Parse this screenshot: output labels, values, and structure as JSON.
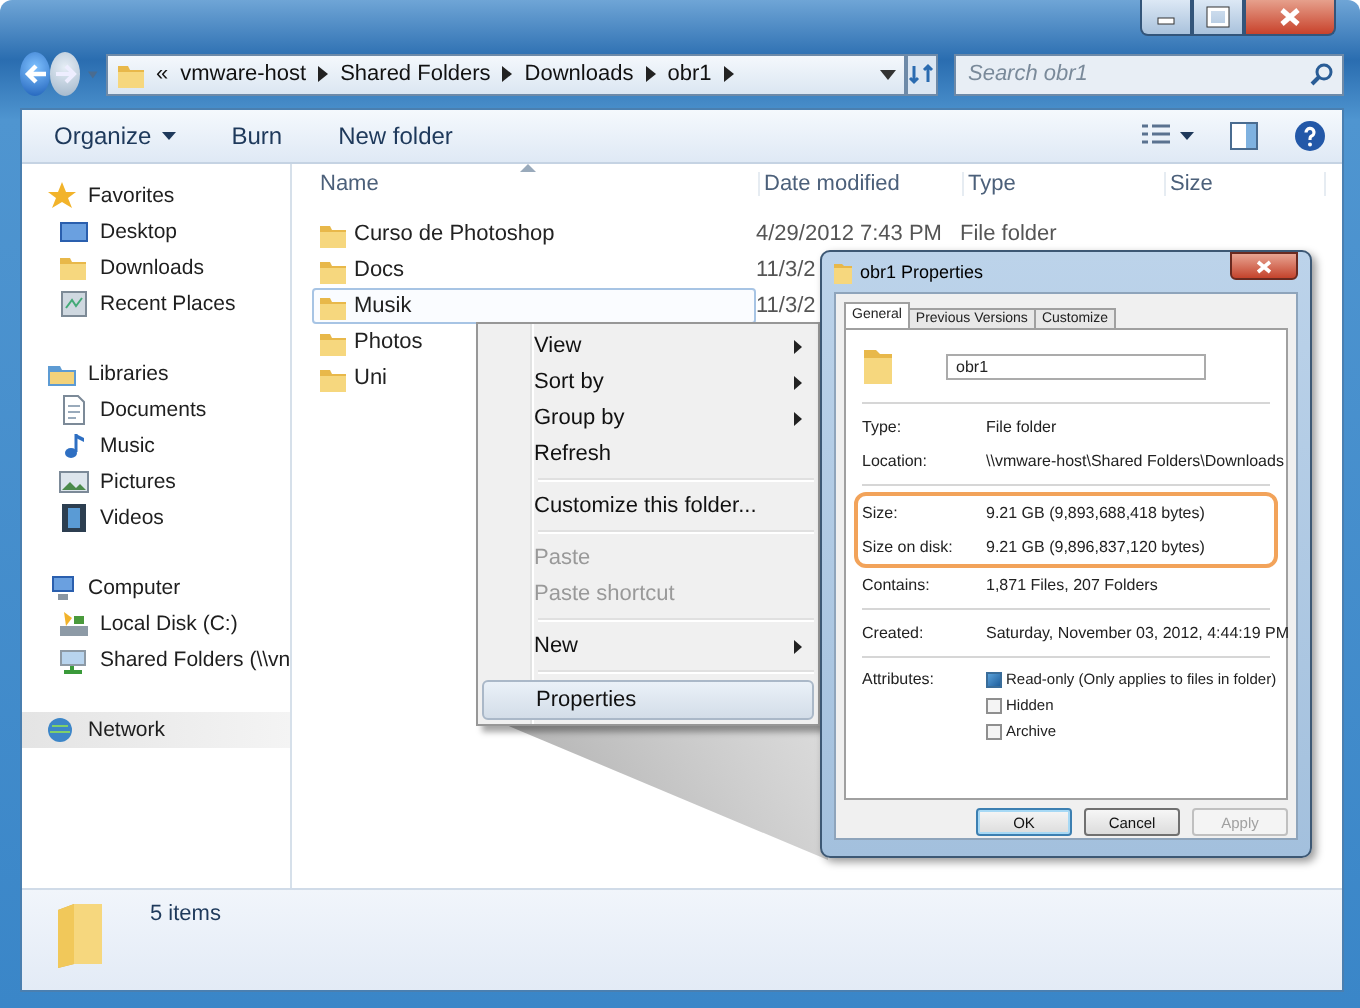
{
  "address_bar": {
    "overflow": "«",
    "crumbs": [
      "vmware-host",
      "Shared Folders",
      "Downloads",
      "obr1"
    ]
  },
  "search": {
    "placeholder": "Search obr1"
  },
  "toolbar": {
    "buttons": [
      {
        "label": "Organize",
        "dropdown": true
      },
      {
        "label": "Burn",
        "dropdown": false
      },
      {
        "label": "New folder",
        "dropdown": false
      }
    ]
  },
  "sidebar": {
    "groups": [
      {
        "label": "Favorites",
        "kind": "star",
        "selected": false,
        "children": [
          {
            "label": "Desktop",
            "kind": "desktop"
          },
          {
            "label": "Downloads",
            "kind": "folder"
          },
          {
            "label": "Recent Places",
            "kind": "recent"
          }
        ]
      },
      {
        "label": "Libraries",
        "kind": "library",
        "selected": false,
        "children": [
          {
            "label": "Documents",
            "kind": "document"
          },
          {
            "label": "Music",
            "kind": "music"
          },
          {
            "label": "Pictures",
            "kind": "pictures"
          },
          {
            "label": "Videos",
            "kind": "videos"
          }
        ]
      },
      {
        "label": "Computer",
        "kind": "computer",
        "selected": false,
        "children": [
          {
            "label": "Local Disk (C:)",
            "kind": "disk"
          },
          {
            "label": "Shared Folders (\\\\vn",
            "kind": "share"
          }
        ]
      },
      {
        "label": "Network",
        "kind": "network",
        "selected": true
      }
    ]
  },
  "table": {
    "columns": [
      "Name",
      "Date modified",
      "Type",
      "Size"
    ],
    "rows": [
      {
        "name": "Curso de Photoshop",
        "date": "4/29/2012 7:43 PM",
        "type": "File folder",
        "selected": false
      },
      {
        "name": "Docs",
        "date": "11/3/2",
        "selected": false
      },
      {
        "name": "Musik",
        "date": "11/3/2",
        "selected": true
      },
      {
        "name": "Photos",
        "selected": false
      },
      {
        "name": "Uni",
        "selected": false
      }
    ]
  },
  "context_menu": {
    "items": [
      {
        "kind": "item",
        "label": "View",
        "submenu": true,
        "disabled": false,
        "selected": false
      },
      {
        "kind": "item",
        "label": "Sort by",
        "submenu": true,
        "disabled": false,
        "selected": false
      },
      {
        "kind": "item",
        "label": "Group by",
        "submenu": true,
        "disabled": false,
        "selected": false
      },
      {
        "kind": "item",
        "label": "Refresh",
        "submenu": false,
        "disabled": false,
        "selected": false
      },
      {
        "kind": "separator"
      },
      {
        "kind": "item",
        "label": "Customize this folder...",
        "submenu": false,
        "disabled": false,
        "selected": false
      },
      {
        "kind": "separator"
      },
      {
        "kind": "item",
        "label": "Paste",
        "submenu": false,
        "disabled": true,
        "selected": false
      },
      {
        "kind": "item",
        "label": "Paste shortcut",
        "submenu": false,
        "disabled": true,
        "selected": false
      },
      {
        "kind": "separator"
      },
      {
        "kind": "item",
        "label": "New",
        "submenu": true,
        "disabled": false,
        "selected": false
      },
      {
        "kind": "separator"
      },
      {
        "kind": "item",
        "label": "Properties",
        "submenu": false,
        "disabled": false,
        "selected": true
      }
    ]
  },
  "dialog": {
    "title": "obr1 Properties",
    "tabs": [
      {
        "label": "General",
        "selected": true
      },
      {
        "label": "Previous Versions",
        "selected": false
      },
      {
        "label": "Customize",
        "selected": false
      }
    ],
    "name_field": {
      "value": "obr1"
    },
    "sections": [
      [
        {
          "label": "Type:",
          "value": "File folder",
          "highlighted": false
        },
        {
          "label": "Location:",
          "value": "\\\\vmware-host\\Shared Folders\\Downloads",
          "highlighted": false
        }
      ],
      [
        {
          "label": "Size:",
          "value": "9.21 GB (9,893,688,418 bytes)",
          "highlighted": true
        },
        {
          "label": "Size on disk:",
          "value": "9.21 GB (9,896,837,120 bytes)",
          "highlighted": true
        },
        {
          "label": "Contains:",
          "value": "1,871 Files, 207 Folders",
          "highlighted": false
        }
      ],
      [
        {
          "label": "Created:",
          "value": "Saturday, November 03, 2012, 4:44:19 PM",
          "highlighted": false
        }
      ]
    ],
    "attributes_label": "Attributes:",
    "attributes": [
      {
        "label": "Read-only (Only applies to files in folder)",
        "checked": true
      },
      {
        "label": "Hidden",
        "checked": false
      },
      {
        "label": "Archive",
        "checked": false
      }
    ],
    "buttons": [
      {
        "label": "OK",
        "default": true,
        "disabled": false
      },
      {
        "label": "Cancel",
        "default": false,
        "disabled": false
      },
      {
        "label": "Apply",
        "default": false,
        "disabled": true
      }
    ]
  },
  "status_bar": {
    "text": "5 items"
  }
}
